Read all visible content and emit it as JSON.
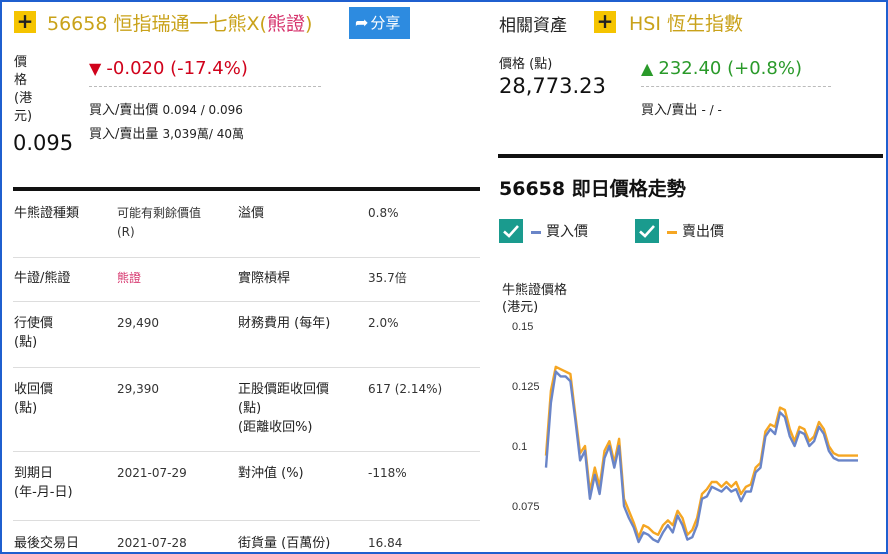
{
  "left": {
    "title_code": "56658",
    "title_name": "恒指瑞通一七熊X",
    "title_tag_open": "(",
    "title_tag": "熊證",
    "title_tag_close": ")",
    "share_label": "分享",
    "price_label": [
      "價",
      "格",
      "(港",
      "元)"
    ],
    "price": "0.095",
    "change": "-0.020 (-17.4%)",
    "bid_ask_price_label": "買入/賣出價",
    "bid_ask_price_value": "0.094 / 0.096",
    "bid_ask_volume_label": "買入/賣出量",
    "bid_ask_volume_value": "3,039萬/ 40萬"
  },
  "right": {
    "related_label": "相關資產",
    "hsi_title": "HSI 恆生指數",
    "price_label": "價格 (點)",
    "price": "28,773.23",
    "change": "232.40 (+0.8%)",
    "bid_ask_label": "買入/賣出",
    "bid_ask_value": "- / -",
    "chart_title": "56658 即日價格走勢",
    "legend_bid": "買入價",
    "legend_ask": "賣出價",
    "chart_ylabel_1": "牛熊證價格",
    "chart_ylabel_2": "(港元)"
  },
  "table": [
    {
      "k1": [
        "牛熊證種類"
      ],
      "v1": [
        "可能有剩餘價值",
        "(R)"
      ],
      "k2": [
        "溢價"
      ],
      "v2": [
        "0.8%"
      ]
    },
    {
      "k1": [
        "牛證/熊證"
      ],
      "v1": [
        "熊證"
      ],
      "k2": [
        "實際槓桿"
      ],
      "v2": [
        "35.7倍"
      ]
    },
    {
      "k1": [
        "行使價",
        "(點)"
      ],
      "v1": [
        "29,490"
      ],
      "k2": [
        "財務費用 (每年)"
      ],
      "v2": [
        "2.0%"
      ]
    },
    {
      "k1": [
        "收回價",
        "(點)"
      ],
      "v1": [
        "29,390"
      ],
      "k2": [
        "正股價距收回價",
        "(點)",
        "(距離收回%)"
      ],
      "v2": [
        "617 (2.14%)"
      ]
    },
    {
      "k1": [
        "到期日",
        "(年-月-日)"
      ],
      "v1": [
        "2021-07-29"
      ],
      "k2": [
        "對沖值 (%)"
      ],
      "v2": [
        "-118%"
      ]
    },
    {
      "k1": [
        "最後交易日"
      ],
      "v1": [
        "2021-07-28"
      ],
      "k2": [
        "街貨量 (百萬份)"
      ],
      "v2": [
        "16.84"
      ]
    }
  ],
  "colors": {
    "accent": "#f5c400",
    "bear": "#d6336c",
    "negative": "#d0021b",
    "positive": "#2a9a2a",
    "share_button": "#2d8be0",
    "check": "#1a9b8e",
    "bid_line": "#6a85c8",
    "ask_line": "#f5a623"
  },
  "icons": {
    "add_left": "plus-icon",
    "add_right": "plus-icon",
    "share": "share-arrow-icon",
    "down": "triangle-down-icon",
    "up": "triangle-up-icon",
    "check": "check-icon"
  },
  "chart_data": {
    "type": "line",
    "title": "56658 即日價格走勢",
    "ylabel": "牛熊證價格 (港元)",
    "yticks": [
      "0.15",
      "0.125",
      "0.1",
      "0.075"
    ],
    "ylim": [
      0.06,
      0.15
    ],
    "legend": "top-left",
    "series": [
      {
        "name": "買入價",
        "color": "#6a85c8",
        "values": [
          0.091,
          0.118,
          0.131,
          0.129,
          0.129,
          0.127,
          0.111,
          0.094,
          0.098,
          0.078,
          0.088,
          0.08,
          0.095,
          0.1,
          0.091,
          0.1,
          0.075,
          0.07,
          0.066,
          0.06,
          0.064,
          0.063,
          0.061,
          0.06,
          0.064,
          0.067,
          0.064,
          0.071,
          0.067,
          0.061,
          0.062,
          0.067,
          0.078,
          0.079,
          0.083,
          0.082,
          0.081,
          0.083,
          0.081,
          0.082,
          0.077,
          0.081,
          0.081,
          0.089,
          0.091,
          0.104,
          0.107,
          0.105,
          0.114,
          0.112,
          0.104,
          0.1,
          0.106,
          0.105,
          0.1,
          0.102,
          0.108,
          0.105,
          0.098,
          0.095,
          0.094,
          0.094,
          0.094,
          0.094,
          0.094
        ]
      },
      {
        "name": "賣出價",
        "color": "#f5a623",
        "values": [
          0.096,
          0.123,
          0.133,
          0.132,
          0.131,
          0.13,
          0.113,
          0.097,
          0.1,
          0.081,
          0.091,
          0.083,
          0.098,
          0.102,
          0.093,
          0.103,
          0.078,
          0.073,
          0.068,
          0.062,
          0.067,
          0.066,
          0.064,
          0.063,
          0.067,
          0.069,
          0.067,
          0.073,
          0.07,
          0.063,
          0.065,
          0.07,
          0.08,
          0.082,
          0.085,
          0.085,
          0.083,
          0.085,
          0.083,
          0.085,
          0.08,
          0.083,
          0.084,
          0.091,
          0.093,
          0.106,
          0.109,
          0.108,
          0.116,
          0.115,
          0.107,
          0.102,
          0.108,
          0.107,
          0.102,
          0.104,
          0.11,
          0.107,
          0.1,
          0.097,
          0.096,
          0.096,
          0.096,
          0.096,
          0.096
        ]
      }
    ]
  }
}
